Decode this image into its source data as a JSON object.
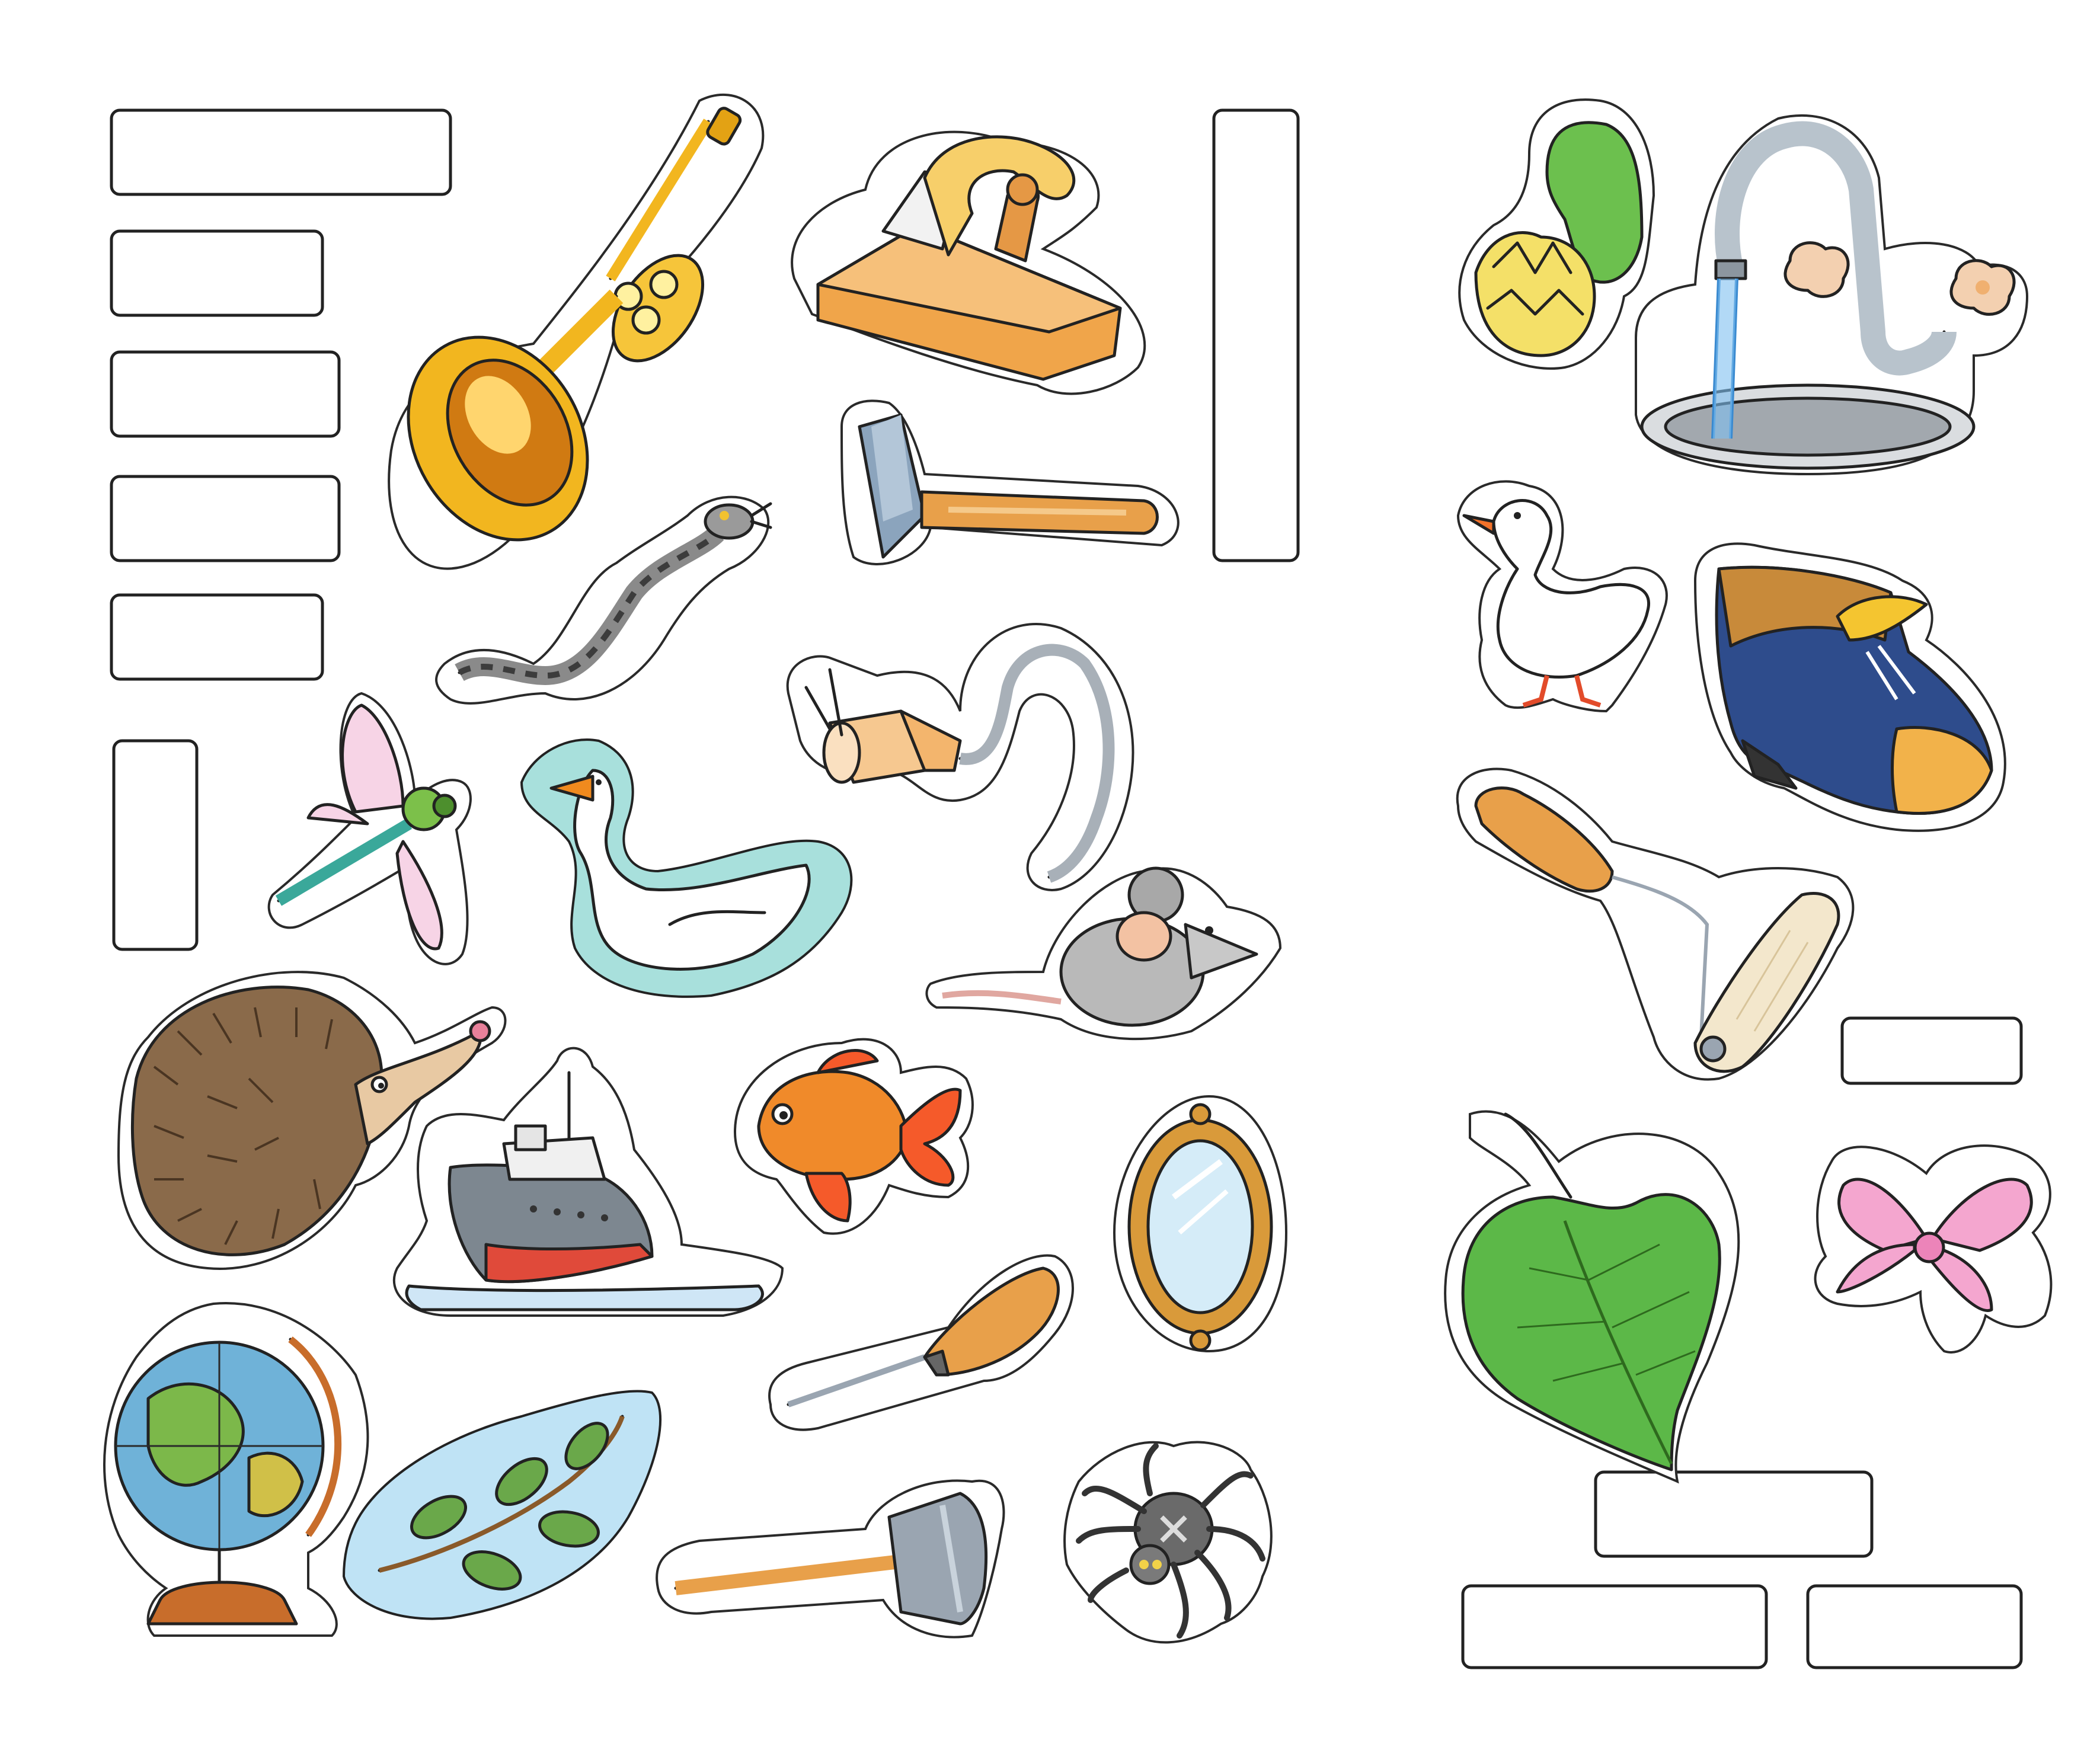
{
  "sheet": {
    "label_slots": [
      {
        "orientation": "horizontal",
        "text": ""
      },
      {
        "orientation": "horizontal",
        "text": ""
      },
      {
        "orientation": "horizontal",
        "text": ""
      },
      {
        "orientation": "horizontal",
        "text": ""
      },
      {
        "orientation": "horizontal",
        "text": ""
      },
      {
        "orientation": "vertical",
        "text": ""
      },
      {
        "orientation": "vertical",
        "text": ""
      },
      {
        "orientation": "horizontal",
        "text": ""
      },
      {
        "orientation": "horizontal",
        "text": ""
      },
      {
        "orientation": "horizontal",
        "text": ""
      },
      {
        "orientation": "horizontal",
        "text": ""
      }
    ],
    "stickers": [
      {
        "icon": "trumpet-icon"
      },
      {
        "icon": "wood-plane-icon"
      },
      {
        "icon": "hammer-icon"
      },
      {
        "icon": "snake-icon"
      },
      {
        "icon": "electric-plug-icon"
      },
      {
        "icon": "dragonfly-icon"
      },
      {
        "icon": "swimming-goose-icon"
      },
      {
        "icon": "mouse-icon"
      },
      {
        "icon": "hedgehog-icon"
      },
      {
        "icon": "ship-icon"
      },
      {
        "icon": "goldfish-icon"
      },
      {
        "icon": "mirror-icon"
      },
      {
        "icon": "screwdriver-icon"
      },
      {
        "icon": "globe-icon"
      },
      {
        "icon": "branch-icon"
      },
      {
        "icon": "axe-icon"
      },
      {
        "icon": "spider-icon"
      },
      {
        "icon": "water-lily-icon"
      },
      {
        "icon": "tap-sink-icon"
      },
      {
        "icon": "duck-icon"
      },
      {
        "icon": "shoe-icon"
      },
      {
        "icon": "paint-roller-icon"
      },
      {
        "icon": "leaf-icon"
      },
      {
        "icon": "bow-icon"
      }
    ],
    "colors": {
      "outline": "#222222",
      "gold": "#f2b61f",
      "wood": "#e8a04a",
      "steel": "#9aa5b1",
      "green": "#5cb848",
      "teal": "#8fd3d0",
      "pink": "#f4a6cf",
      "blue": "#2e4c8c"
    }
  }
}
